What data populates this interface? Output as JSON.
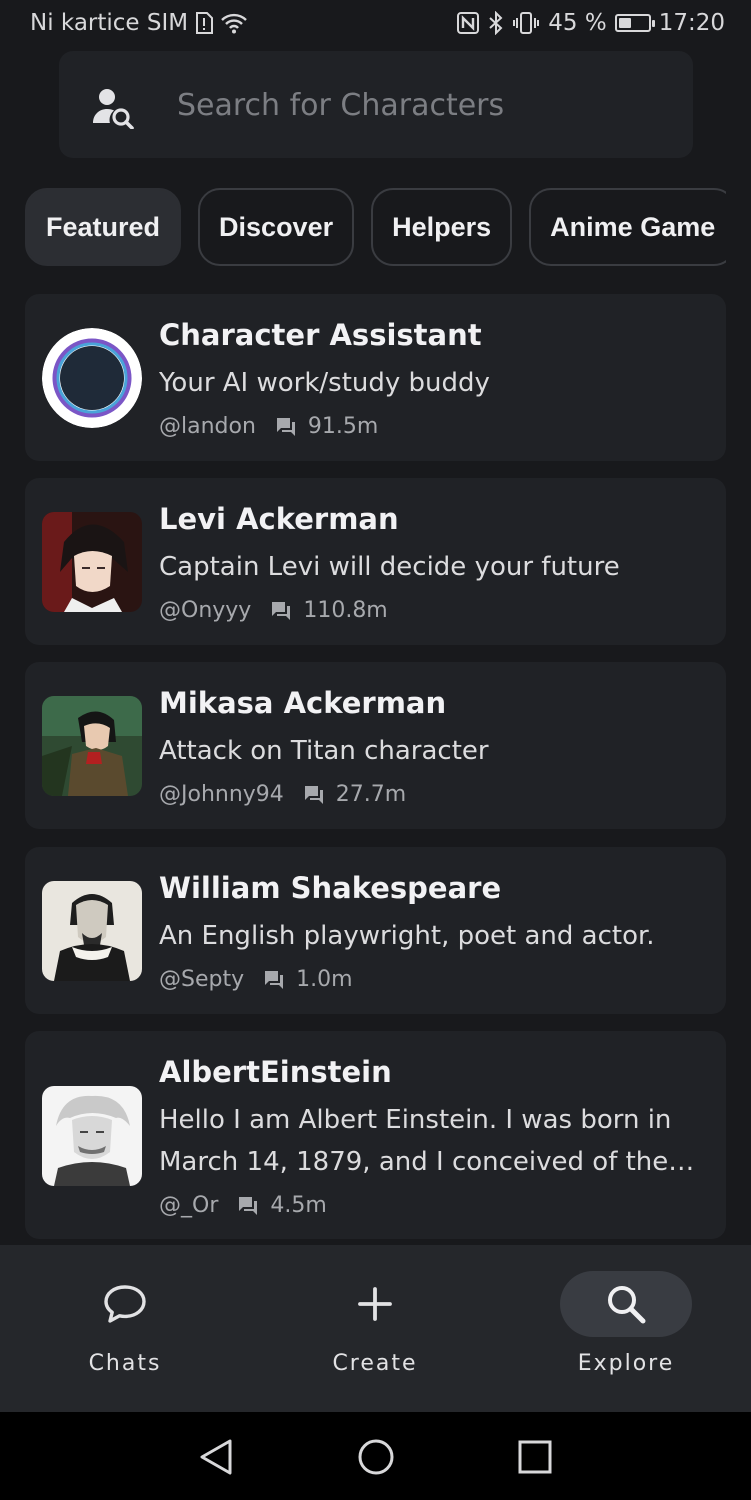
{
  "status_bar": {
    "carrier": "Ni kartice SIM",
    "battery_percent": "45 %",
    "battery_level": 0.45,
    "time": "17:20"
  },
  "search": {
    "placeholder": "Search for Characters"
  },
  "tabs": [
    {
      "label": "Featured",
      "active": true
    },
    {
      "label": "Discover",
      "active": false
    },
    {
      "label": "Helpers",
      "active": false
    },
    {
      "label": "Anime Game",
      "active": false
    }
  ],
  "characters": [
    {
      "name": "Character Assistant",
      "description": "Your AI work/study buddy",
      "author": "@landon",
      "chats": "91.5m"
    },
    {
      "name": "Levi Ackerman",
      "description": "Captain Levi will decide your future",
      "author": "@Onyyy",
      "chats": "110.8m"
    },
    {
      "name": "Mikasa Ackerman",
      "description": "Attack on Titan character",
      "author": "@Johnny94",
      "chats": "27.7m"
    },
    {
      "name": "William Shakespeare",
      "description": "An English playwright, poet and actor.",
      "author": "@Septy",
      "chats": "1.0m"
    },
    {
      "name": "AlbertEinstein",
      "description": "Hello I am Albert Einstein. I was born in March 14, 1879, and I conceived of the…",
      "author": "@_Or",
      "chats": "4.5m"
    }
  ],
  "bottom_nav": [
    {
      "label": "Chats",
      "icon": "chat-bubble-icon",
      "active": false
    },
    {
      "label": "Create",
      "icon": "plus-icon",
      "active": false
    },
    {
      "label": "Explore",
      "icon": "search-icon",
      "active": true
    }
  ],
  "colors": {
    "background": "#18191c",
    "card": "#202226",
    "nav": "#25272b",
    "active_pill": "#393c42"
  }
}
